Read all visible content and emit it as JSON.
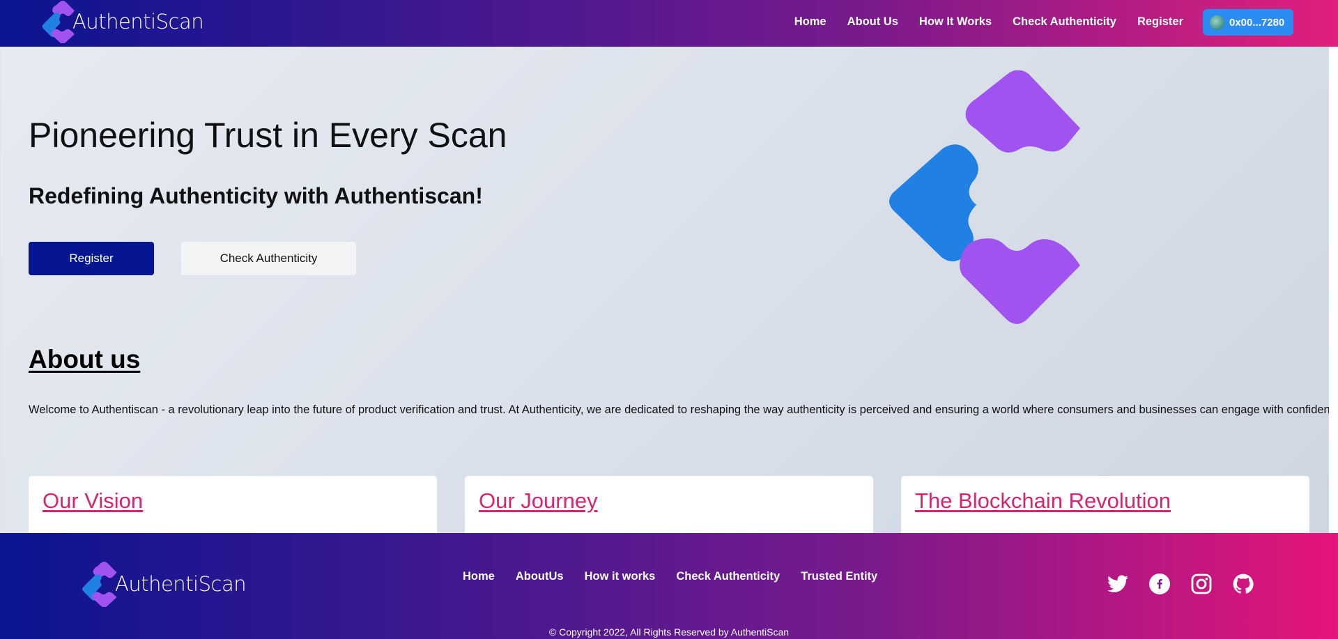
{
  "brand": {
    "name": "AuthentiScan"
  },
  "header": {
    "nav": [
      "Home",
      "About Us",
      "How It Works",
      "Check Authenticity",
      "Register"
    ],
    "wallet_label": "0x00...7280"
  },
  "hero": {
    "title": "Pioneering Trust in Every Scan",
    "subtitle": "Redefining Authenticity with Authentiscan!",
    "primary_button": "Register",
    "secondary_button": "Check Authenticity"
  },
  "about": {
    "title": "About us",
    "text": "Welcome to Authentiscan - a revolutionary leap into the future of product verification and trust. At Authenticity, we are dedicated to reshaping the way authenticity is perceived and ensuring a world where consumers and businesses can engage with confidence.",
    "cards": [
      "Our Vision",
      "Our Journey",
      "The Blockchain Revolution"
    ]
  },
  "footer": {
    "nav": [
      "Home",
      "AboutUs",
      "How it works",
      "Check Authenticity",
      "Trusted Entity"
    ],
    "socials": [
      "twitter-icon",
      "facebook-icon",
      "instagram-icon",
      "github-icon"
    ],
    "copyright": "© Copyright 2022, All Rights Reserved by AuthentiScan"
  },
  "colors": {
    "primary": "#061691",
    "accent_pink": "#d3266f",
    "logo_purple": "#a153f0",
    "logo_blue": "#2080e4",
    "wallet_blue": "#2b8cf2"
  }
}
